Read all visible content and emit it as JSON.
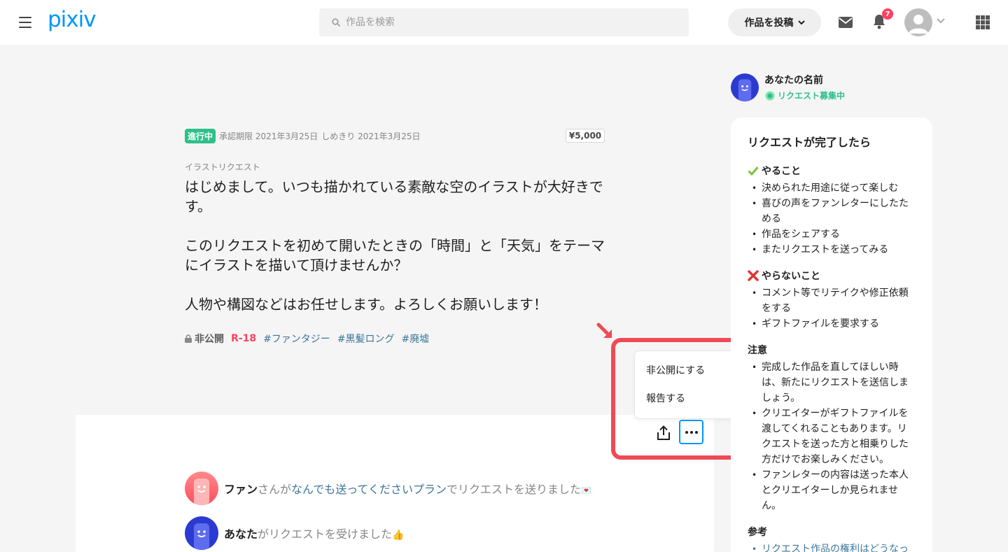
{
  "header": {
    "logo": "pixiv",
    "search_placeholder": "作品を検索",
    "post_button": "作品を投稿",
    "notification_count": "7"
  },
  "request": {
    "status_badge": "進行中",
    "approval_deadline": "承認期限 2021年3月25日",
    "due_date": "しめきり 2021年3月25日",
    "price": "¥5,000",
    "type": "イラストリクエスト",
    "body": "はじめまして。いつも描かれている素敵な空のイラストが大好きです。\n\nこのリクエストを初めて開いたときの「時間」と「天気」をテーマにイラストを描いて頂けませんか？\n\n人物や構図などはお任せします。よろしくお願いします！",
    "visibility": "非公開",
    "rating": "R-18",
    "tags": [
      "#ファンタジー",
      "#黒髪ロング",
      "#廃墟"
    ]
  },
  "menu": {
    "items": [
      "非公開にする",
      "報告する"
    ]
  },
  "activity": [
    {
      "name": "ファン",
      "pre": "さんが",
      "plan": "なんでも送ってくださいプラン",
      "post": "でリクエストを送りました",
      "emoji": "💌"
    },
    {
      "name": "あなた",
      "post": "がリクエストを受けました",
      "emoji": "👍"
    }
  ],
  "sidebar": {
    "user_name": "あなたの名前",
    "request_status": "リクエスト募集中",
    "guide_title": "リクエストが完了したら",
    "do_title": "やること",
    "do_items": [
      "決められた用途に従って楽しむ",
      "喜びの声をファンレターにしたためる",
      "作品をシェアする",
      "またリクエストを送ってみる"
    ],
    "dont_title": "やらないこと",
    "dont_items": [
      "コメント等でリテイクや修正依頼をする",
      "ギフトファイルを要求する"
    ],
    "note_title": "注意",
    "note_items": [
      "完成した作品を直してほしい時は、新たにリクエストを送信しましょう。",
      "クリエイターがギフトファイルを渡してくれることもあります。リクエストを送った方と相乗りした方だけでお楽しみください。",
      "ファンレターの内容は送った本人とクリエイターしか見られません。"
    ],
    "ref_title": "参考",
    "ref_items": [
      "リクエスト作品の権利はどうなっ"
    ]
  },
  "colors": {
    "brand": "#0096fa",
    "progress_green": "#2ec08b",
    "r18_red": "#ff4060",
    "link": "#3d7699",
    "highlight_red": "#ef4a55"
  },
  "icons": [
    "menu-icon",
    "search-icon",
    "chevron-down-icon",
    "mail-icon",
    "bell-icon",
    "user-icon",
    "apps-icon",
    "lock-icon",
    "share-icon",
    "more-icon",
    "check-icon",
    "cross-icon",
    "speech-bubble-icon"
  ]
}
